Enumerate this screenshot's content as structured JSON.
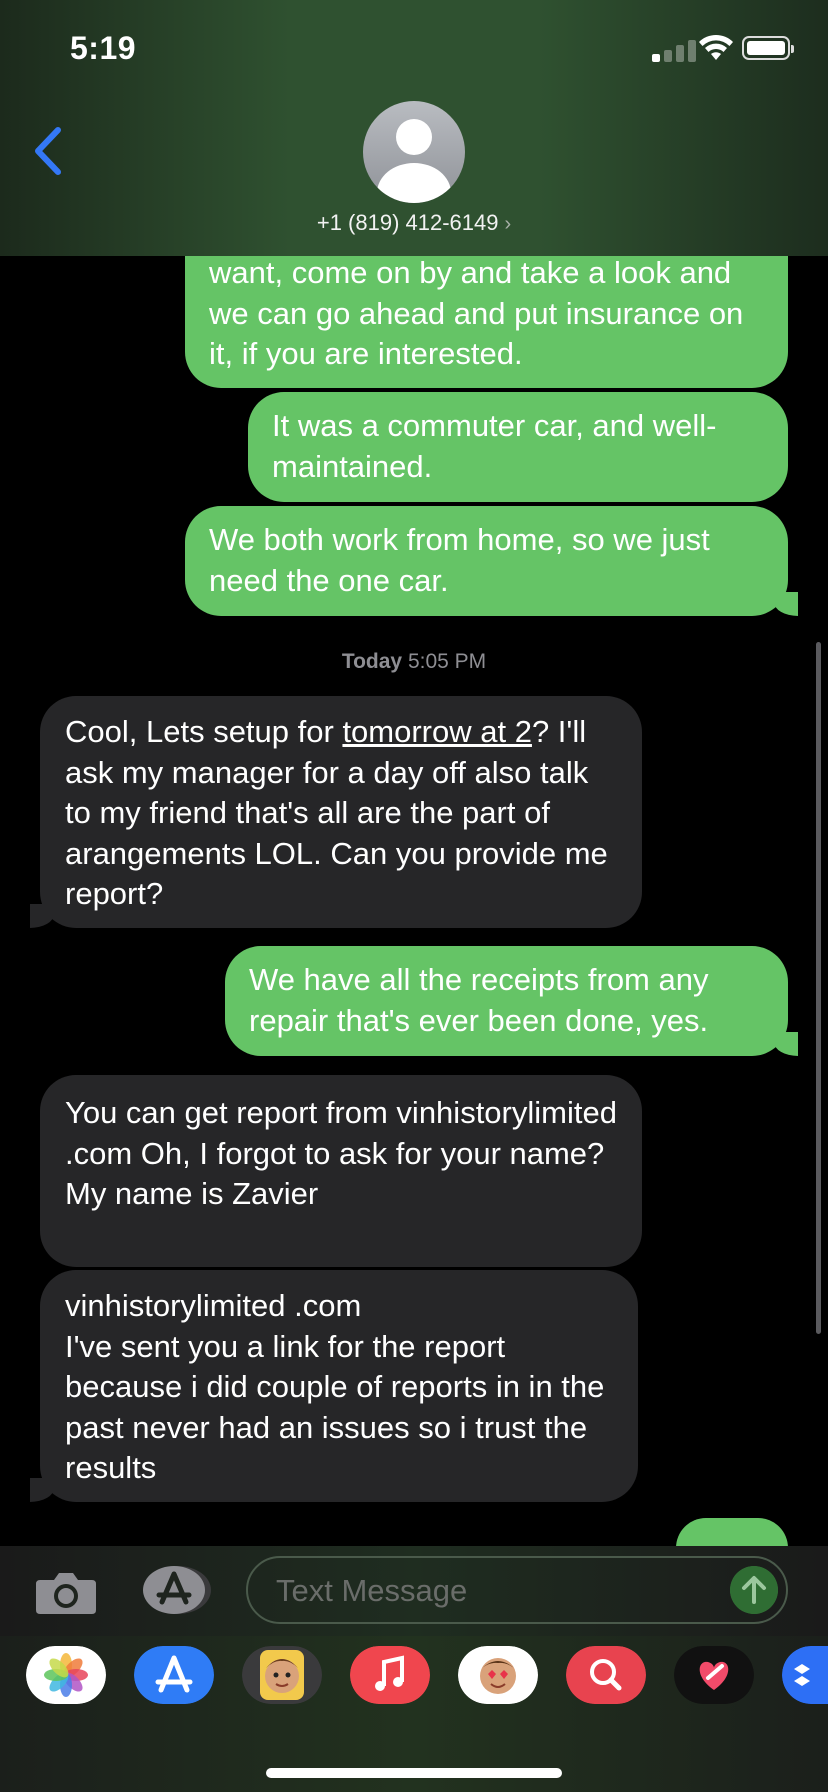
{
  "status": {
    "time": "5:19"
  },
  "header": {
    "contact": "+1 (819) 412-6149",
    "chevron": "›"
  },
  "messages": {
    "m1": "want, come on by and take a look and we can go ahead and put insurance on it, if you are interested.",
    "m2": "It was a commuter car, and well-maintained.",
    "m3": "We both work from home, so we just need the one car.",
    "timestamp_day": "Today",
    "timestamp_time": "5:05 PM",
    "m4_a": "Cool, Lets setup for ",
    "m4_link": "tomorrow at 2",
    "m4_b": "? I'll ask my manager for a day off also talk to my friend that's all are the part of arangements LOL. Can you provide me report?",
    "m5": "We have all the receipts from any repair that's ever been done, yes.",
    "m6": "You can get report from vinhistorylimited .com Oh, I forgot to ask for your name? My name is Zavier",
    "m7_line1": "vinhistorylimited .com",
    "m7_rest": "I've sent you a link for the report because i did couple of reports in in the past never had an issues so i trust the results"
  },
  "input": {
    "placeholder": "Text Message"
  },
  "apps": [
    "photos-icon",
    "app-store-icon",
    "memoji-icon",
    "music-icon",
    "memoji-stickers-icon",
    "search-images-icon",
    "digital-touch-icon",
    "dropbox-icon"
  ],
  "colors": {
    "outgoing": "#65c466",
    "incoming": "#262628",
    "accent": "#3478f6"
  }
}
